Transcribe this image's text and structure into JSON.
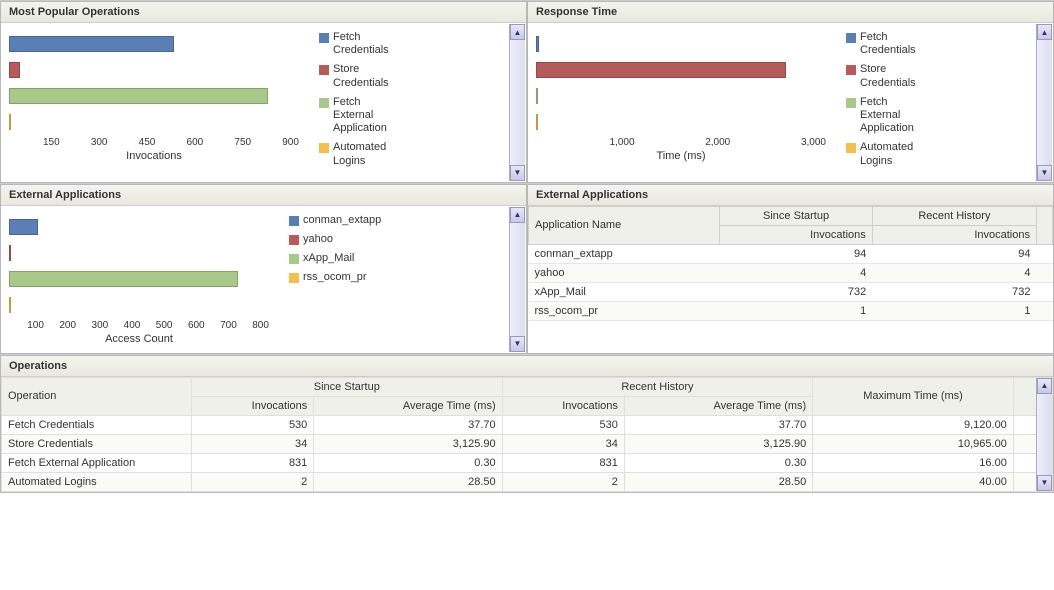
{
  "panels": {
    "popular": {
      "title": "Most Popular Operations",
      "axis": "Invocations"
    },
    "response": {
      "title": "Response Time",
      "axis": "Time (ms)"
    },
    "extapps_chart": {
      "title": "External Applications",
      "axis": "Access Count"
    },
    "extapps_table": {
      "title": "External Applications"
    },
    "operations": {
      "title": "Operations"
    }
  },
  "colors": {
    "fetch_cred": "#5b7fb5",
    "store_cred": "#b55b5b",
    "fetch_ext": "#a8c98a",
    "auto_login": "#f0c050",
    "conman": "#5b7fb5",
    "yahoo": "#b55b5b",
    "xapp": "#a8c98a",
    "rss": "#f0c050"
  },
  "legend_ops": [
    {
      "key": "fetch_cred",
      "label": "Fetch\nCredentials"
    },
    {
      "key": "store_cred",
      "label": "Store\nCredentials"
    },
    {
      "key": "fetch_ext",
      "label": "Fetch\nExternal\nApplication"
    },
    {
      "key": "auto_login",
      "label": "Automated\nLogins"
    }
  ],
  "legend_apps": [
    {
      "key": "conman",
      "label": "conman_extapp"
    },
    {
      "key": "yahoo",
      "label": "yahoo"
    },
    {
      "key": "xapp",
      "label": "xApp_Mail"
    },
    {
      "key": "rss",
      "label": "rss_ocom_pr"
    }
  ],
  "chart_data": [
    {
      "type": "bar",
      "orientation": "horizontal",
      "title": "Most Popular Operations",
      "xlabel": "Invocations",
      "xlim": [
        0,
        900
      ],
      "xticks": [
        150,
        300,
        450,
        600,
        750,
        900
      ],
      "categories": [
        "Fetch Credentials",
        "Store Credentials",
        "Fetch External Application",
        "Automated Logins"
      ],
      "values": [
        530,
        34,
        831,
        2
      ]
    },
    {
      "type": "bar",
      "orientation": "horizontal",
      "title": "Response Time",
      "xlabel": "Time (ms)",
      "xlim": [
        0,
        3500
      ],
      "xticks": [
        1000,
        2000,
        3000
      ],
      "categories": [
        "Fetch Credentials",
        "Store Credentials",
        "Fetch External Application",
        "Automated Logins"
      ],
      "values": [
        38,
        3126,
        0.3,
        29
      ]
    },
    {
      "type": "bar",
      "orientation": "horizontal",
      "title": "External Applications",
      "xlabel": "Access Count",
      "xlim": [
        0,
        800
      ],
      "xticks": [
        100,
        200,
        300,
        400,
        500,
        600,
        700,
        800
      ],
      "categories": [
        "conman_extapp",
        "yahoo",
        "xApp_Mail",
        "rss_ocom_pr"
      ],
      "values": [
        94,
        4,
        732,
        1
      ]
    }
  ],
  "extapps_table": {
    "cols": {
      "app": "Application Name",
      "startup": "Since Startup",
      "recent": "Recent History",
      "inv": "Invocations"
    },
    "rows": [
      {
        "name": "conman_extapp",
        "startup_inv": "94",
        "recent_inv": "94"
      },
      {
        "name": "yahoo",
        "startup_inv": "4",
        "recent_inv": "4"
      },
      {
        "name": "xApp_Mail",
        "startup_inv": "732",
        "recent_inv": "732"
      },
      {
        "name": "rss_ocom_pr",
        "startup_inv": "1",
        "recent_inv": "1"
      }
    ]
  },
  "ops_table": {
    "cols": {
      "op": "Operation",
      "startup": "Since Startup",
      "recent": "Recent History",
      "inv": "Invocations",
      "avg": "Average Time (ms)",
      "max": "Maximum Time (ms)"
    },
    "rows": [
      {
        "op": "Fetch Credentials",
        "s_inv": "530",
        "s_avg": "37.70",
        "r_inv": "530",
        "r_avg": "37.70",
        "max": "9,120.00"
      },
      {
        "op": "Store Credentials",
        "s_inv": "34",
        "s_avg": "3,125.90",
        "r_inv": "34",
        "r_avg": "3,125.90",
        "max": "10,965.00"
      },
      {
        "op": "Fetch External Application",
        "s_inv": "831",
        "s_avg": "0.30",
        "r_inv": "831",
        "r_avg": "0.30",
        "max": "16.00"
      },
      {
        "op": "Automated Logins",
        "s_inv": "2",
        "s_avg": "28.50",
        "r_inv": "2",
        "r_avg": "28.50",
        "max": "40.00"
      }
    ]
  }
}
